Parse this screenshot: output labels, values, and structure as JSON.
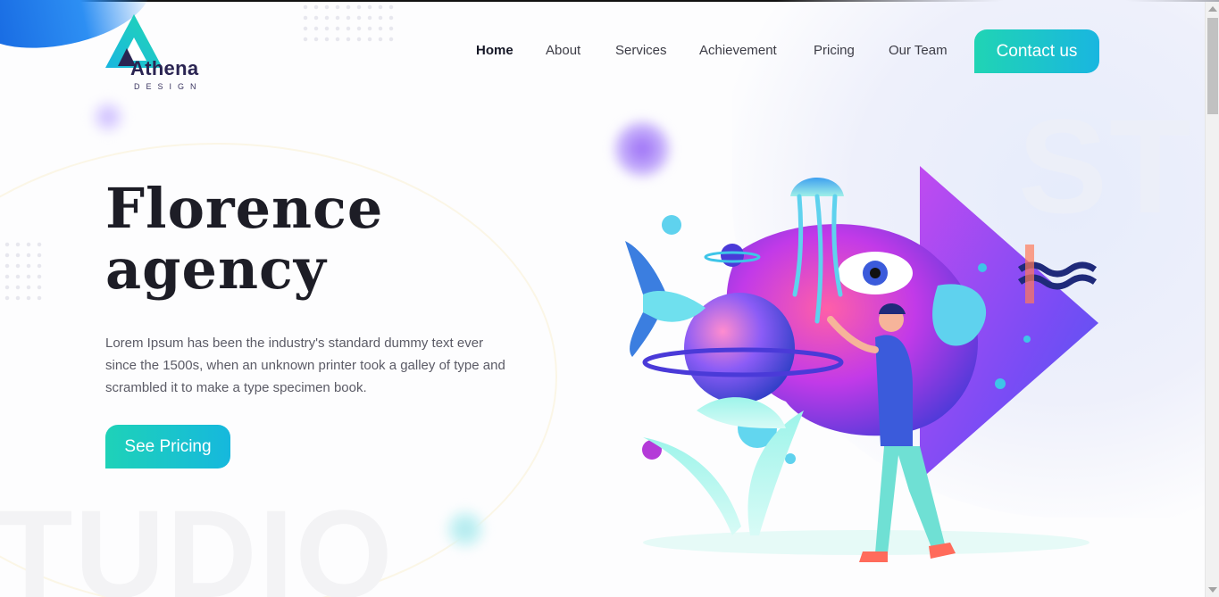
{
  "brand": {
    "name": "Athena",
    "subtitle": "DESIGN",
    "colors": {
      "primary_gradient_start": "#20d4b4",
      "primary_gradient_end": "#19b6e0",
      "text_dark": "#1d1d26"
    }
  },
  "nav": {
    "items": [
      {
        "label": "Home",
        "active": true
      },
      {
        "label": "About",
        "active": false
      },
      {
        "label": "Services",
        "active": false
      },
      {
        "label": "Achievement",
        "active": false
      },
      {
        "label": "Pricing",
        "active": false
      },
      {
        "label": "Our Team",
        "active": false
      }
    ],
    "cta_label": "Contact us"
  },
  "hero": {
    "title_line1": "Florence",
    "title_line2": "agency",
    "description": "Lorem Ipsum has been the industry's standard dummy text ever since the 1500s, when an unknown printer took a galley of type and scrambled it to make a type specimen book.",
    "cta_label": "See Pricing"
  },
  "background": {
    "ghost_left": "TUDIO",
    "ghost_right": "ST"
  },
  "illustration": {
    "icon": "creative-illustration-icon"
  }
}
